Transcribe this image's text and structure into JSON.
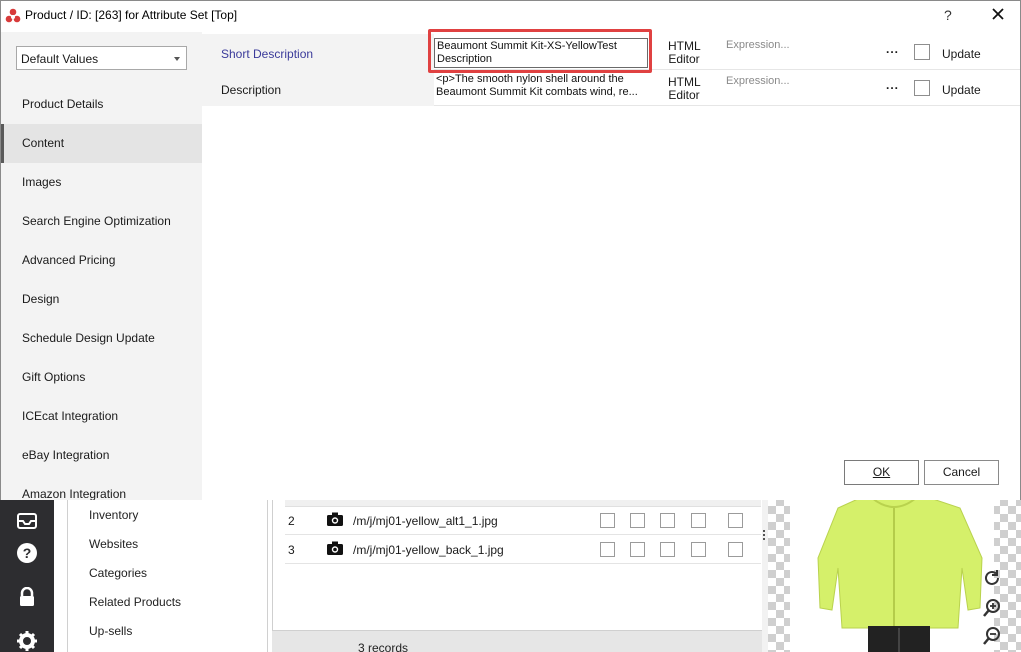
{
  "dialog": {
    "title": "Product / ID: [263] for Attribute Set [Top]",
    "help_label": "?",
    "store_view": "Default Values",
    "nav": [
      {
        "label": "Product Details"
      },
      {
        "label": "Content"
      },
      {
        "label": "Images"
      },
      {
        "label": "Search Engine Optimization"
      },
      {
        "label": "Advanced Pricing"
      },
      {
        "label": "Design"
      },
      {
        "label": "Schedule Design Update"
      },
      {
        "label": "Gift Options"
      },
      {
        "label": "ICEcat Integration"
      },
      {
        "label": "eBay Integration"
      },
      {
        "label": "Amazon Integration"
      }
    ],
    "active_nav": "Content",
    "rows": [
      {
        "label": "Short Description",
        "value": "Beaumont Summit Kit-XS-YellowTest Description",
        "editor": "HTML Editor",
        "expression_placeholder": "Expression...",
        "more": "...",
        "update_label": "Update"
      },
      {
        "label": "Description",
        "value": "<p>The smooth nylon shell around the Beaumont Summit Kit combats wind, re...",
        "editor": "HTML Editor",
        "expression_placeholder": "Expression...",
        "more": "...",
        "update_label": "Update"
      }
    ],
    "ok_label": "OK",
    "cancel_label": "Cancel"
  },
  "background": {
    "menu_items": [
      {
        "label": "Inventory"
      },
      {
        "label": "Websites"
      },
      {
        "label": "Categories"
      },
      {
        "label": "Related Products"
      },
      {
        "label": "Up-sells"
      }
    ],
    "images": [
      {
        "num": "2",
        "path": "/m/j/mj01-yellow_alt1_1.jpg"
      },
      {
        "num": "3",
        "path": "/m/j/mj01-yellow_back_1.jpg"
      }
    ],
    "records": "3 records"
  },
  "colors": {
    "highlight": "#e04141",
    "jacket": "#d5f06a",
    "sidebar_dark": "#2d2d30"
  }
}
